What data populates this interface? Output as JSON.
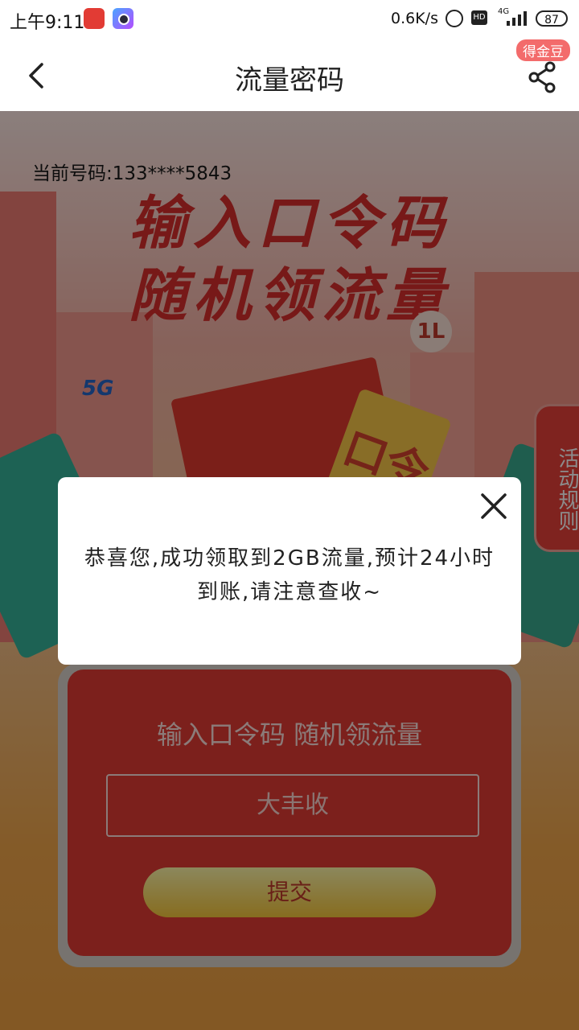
{
  "status_bar": {
    "time": "上午9:11",
    "net_speed": "0.6K/s",
    "hd": "HD",
    "network": "4G",
    "battery": "87"
  },
  "header": {
    "title": "流量密码",
    "badge": "得金豆"
  },
  "banner": {
    "phone_label": "当前号码:133****5843",
    "headline_1": "输入口令码",
    "headline_2": "随机领流量",
    "badge_5g": "5G",
    "coin_text": "1L",
    "ticket_text": "口令"
  },
  "rules_tab": {
    "label": "活动规则"
  },
  "form": {
    "title": "输入口令码 随机领流量",
    "code_value": "大丰收",
    "submit_label": "提交"
  },
  "dialog": {
    "message": "恭喜您,成功领取到2GB流量,预计24小时到账,请注意查收~"
  },
  "colors": {
    "accent_red": "#e23b34",
    "headline_red": "#d92f2c",
    "badge_pink": "#f36b6b"
  }
}
